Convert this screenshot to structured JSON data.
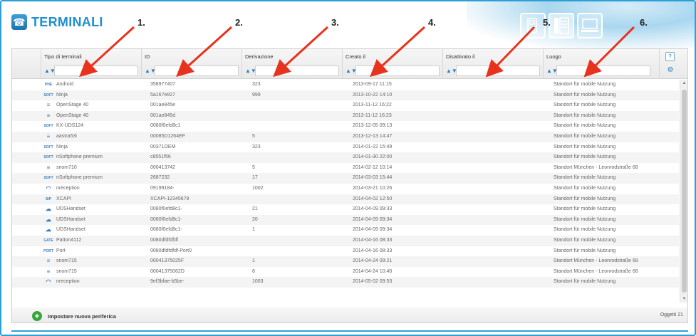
{
  "header": {
    "title": "TERMINALI",
    "icon": "phone-icon",
    "device_icons": [
      "desk-phone-icon",
      "keypad-phone-icon",
      "softphone-icon"
    ]
  },
  "annotations": [
    "1.",
    "2.",
    "3.",
    "4.",
    "5.",
    "6."
  ],
  "columns": [
    {
      "label": "Tipo di terminali"
    },
    {
      "label": "ID"
    },
    {
      "label": "Derivazione"
    },
    {
      "label": "Creato il"
    },
    {
      "label": "Disattivato il"
    },
    {
      "label": "Luogo"
    }
  ],
  "help_label": "?",
  "rows": [
    {
      "badge": "PHE",
      "type": "Android",
      "id": "358977407",
      "ext": "323",
      "created": "2013-09-17 11:15",
      "location": "Standort für mobile Nutzung"
    },
    {
      "badge": "SOFT",
      "type": "Ninja",
      "id": "5a167e827",
      "ext": "999",
      "created": "2013-10-22 14:10",
      "location": "Standort für mobile Nutzung"
    },
    {
      "badge": "≡",
      "type": "OpenStage 40",
      "id": "001ae845e",
      "ext": "",
      "created": "2013-11-12 16:22",
      "location": "Standort für mobile Nutzung"
    },
    {
      "badge": "≡",
      "type": "OpenStage 40",
      "id": "001ae845d",
      "ext": "",
      "created": "2013-11-12 16:23",
      "location": "Standort für mobile Nutzung"
    },
    {
      "badge": "SOFT",
      "type": "KX-UDS124",
      "id": "0080f0efd8c1",
      "ext": "",
      "created": "2013-12-05 09:13",
      "location": "Standort für mobile Nutzung"
    },
    {
      "badge": "≡",
      "type": "aastra53i",
      "id": "00085D1264EF",
      "ext": "5",
      "created": "2013-12-13 14:47",
      "location": "Standort für mobile Nutzung"
    },
    {
      "badge": "SOFT",
      "type": "Ninja",
      "id": "00371OEM",
      "ext": "323",
      "created": "2014-01-22 15:49",
      "location": "Standort für mobile Nutzung"
    },
    {
      "badge": "SOFT",
      "type": "nSoftphone premium",
      "id": "c8551f56",
      "ext": "",
      "created": "2014-01-30 22:00",
      "location": "Standort für mobile Nutzung"
    },
    {
      "badge": "≡",
      "type": "snom710",
      "id": "000413742",
      "ext": "5",
      "created": "2014-02-12 10:14",
      "location": "Standort München - Leonrodstraße 68"
    },
    {
      "badge": "SOFT",
      "type": "nSoftphone premium",
      "id": "2687232",
      "ext": "17",
      "created": "2014-03-03 15:44",
      "location": "Standort für mobile Nutzung"
    },
    {
      "badge": "◠",
      "type": "nreception",
      "id": "09199184-",
      "ext": "1002",
      "created": "2014-03-21 10:26",
      "location": "Standort für mobile Nutzung"
    },
    {
      "badge": "SIP",
      "type": "XCAPI",
      "id": "XCAPI-12345678",
      "ext": "",
      "created": "2014-04-02 12:50",
      "location": "Standort für mobile Nutzung"
    },
    {
      "badge": "☁",
      "type": "UDSHandset",
      "id": "0080f0efd8c1-",
      "ext": "21",
      "created": "2014-04-09 09:33",
      "location": "Standort für mobile Nutzung"
    },
    {
      "badge": "☁",
      "type": "UDSHandset",
      "id": "0080f0efd8c1-",
      "ext": "20",
      "created": "2014-04-09 09:34",
      "location": "Standort für mobile Nutzung"
    },
    {
      "badge": "☁",
      "type": "UDSHandset",
      "id": "0080f0efd8c1-",
      "ext": "1",
      "created": "2014-04-09 09:34",
      "location": "Standort für mobile Nutzung"
    },
    {
      "badge": "GATE",
      "type": "Patton4112",
      "id": "0080dfdfdfdf",
      "ext": "",
      "created": "2014-04-16 08:33",
      "location": "Standort für mobile Nutzung"
    },
    {
      "badge": "PORT",
      "type": "Port",
      "id": "0080dfdfdfdf-Port0",
      "ext": "",
      "created": "2014-04-16 08:33",
      "location": "Standort für mobile Nutzung"
    },
    {
      "badge": "≡",
      "type": "snom715",
      "id": "00041375025F",
      "ext": "1",
      "created": "2014-04-24 09:21",
      "location": "Standort München - Leonrodstraße 68"
    },
    {
      "badge": "≡",
      "type": "snom715",
      "id": "00041375062D",
      "ext": "8",
      "created": "2014-04-24 10:40",
      "location": "Standort München - Leonrodstraße 68"
    },
    {
      "badge": "◠",
      "type": "nreception",
      "id": "9ef3bfae-b5be-",
      "ext": "1003",
      "created": "2014-05-02 09:53",
      "location": "Standort für mobile Nutzung"
    }
  ],
  "footer": {
    "add_label": "Impostare nuova periferica",
    "count_label": "Oggetti 21"
  },
  "colors": {
    "accent": "#2a9fd8",
    "title": "#1f8fd0",
    "arrow": "#e8321e",
    "add": "#3aa53a"
  }
}
